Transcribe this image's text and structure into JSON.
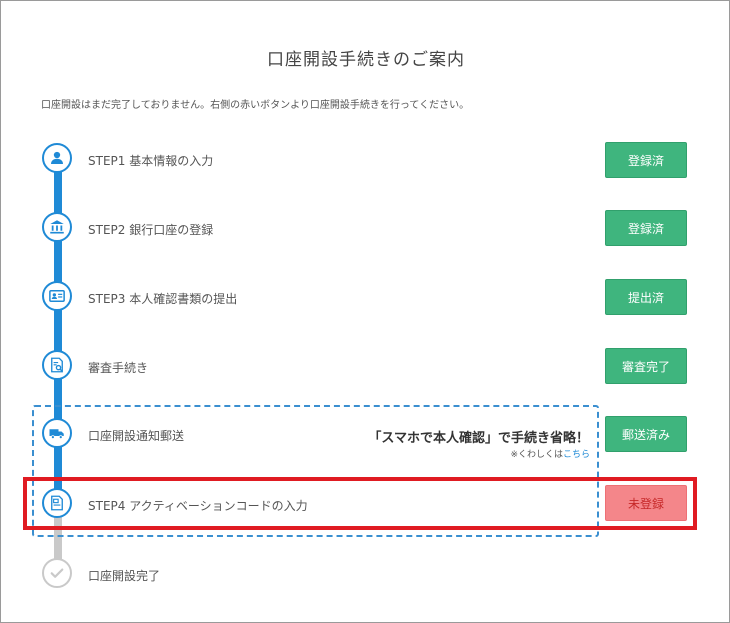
{
  "page": {
    "title": "口座開設手続きのご案内",
    "intro": "口座開設はまだ完了しておりません。右側の赤いボタンより口座開設手続きを行ってください。"
  },
  "steps": [
    {
      "label": "STEP1 基本情報の入力",
      "status": "登録済",
      "icon": "user-icon",
      "status_color": "#3fb57e"
    },
    {
      "label": "STEP2 銀行口座の登録",
      "status": "登録済",
      "icon": "bank-icon",
      "status_color": "#3fb57e"
    },
    {
      "label": "STEP3 本人確認書類の提出",
      "status": "提出済",
      "icon": "id-card-icon",
      "status_color": "#3fb57e"
    },
    {
      "label": "審査手続き",
      "status": "審査完了",
      "icon": "document-search-icon",
      "status_color": "#3fb57e"
    },
    {
      "label": "口座開設通知郵送",
      "status": "郵送済み",
      "icon": "truck-icon",
      "status_color": "#3fb57e"
    },
    {
      "label": "STEP4 アクティベーションコードの入力",
      "status": "未登録",
      "icon": "document-icon",
      "status_color": "#f4868a"
    },
    {
      "label": "口座開設完了",
      "icon": "check-icon"
    }
  ],
  "promo": {
    "main": "「スマホで本人確認」で手続き省略！",
    "sub_prefix": "※くわしくは",
    "sub_link": "こちら"
  },
  "colors": {
    "accent": "#1f8ad6",
    "success": "#3fb57e",
    "pending": "#f4868a",
    "highlight": "#e01b22"
  }
}
